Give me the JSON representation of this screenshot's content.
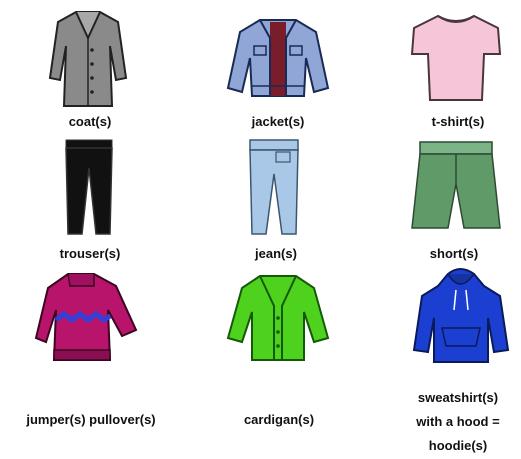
{
  "items": [
    {
      "label": "coat(s)",
      "icon": "coat-icon",
      "color": "#8a8a8a"
    },
    {
      "label": "jacket(s)",
      "icon": "jacket-icon",
      "color": "#8fa6d6"
    },
    {
      "label": "t-shirt(s)",
      "icon": "tshirt-icon",
      "color": "#f5c6d8"
    },
    {
      "label": "trouser(s)",
      "icon": "trousers-icon",
      "color": "#111111"
    },
    {
      "label": "jean(s)",
      "icon": "jeans-icon",
      "color": "#a9c7e6"
    },
    {
      "label": "short(s)",
      "icon": "shorts-icon",
      "color": "#5f9a68"
    },
    {
      "label": "jumper(s) pullover(s)",
      "icon": "jumper-icon",
      "color": "#b8146c"
    },
    {
      "label": "cardigan(s)",
      "icon": "cardigan-icon",
      "color": "#4fd21e"
    },
    {
      "label_lines": [
        "sweatshirt(s)",
        "with a hood =",
        "hoodie(s)"
      ],
      "icon": "hoodie-icon",
      "color": "#1b3fd0"
    }
  ]
}
